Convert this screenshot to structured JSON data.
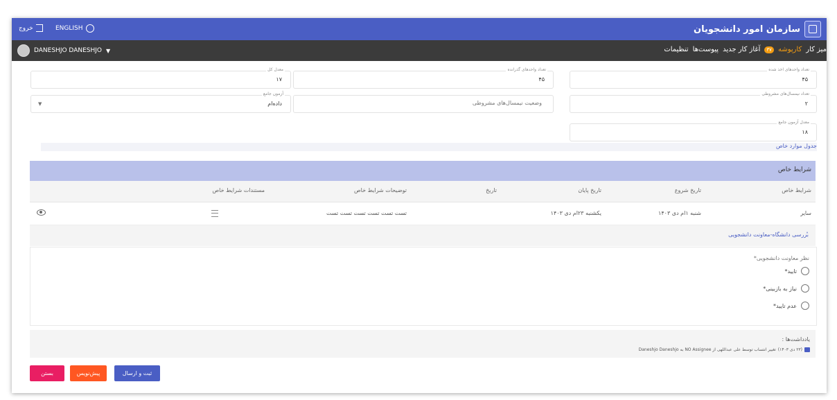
{
  "header": {
    "title": "سازمان امور دانشجویان",
    "language_label": "ENGLISH",
    "logout_label": "خروج",
    "accent_color": "#4a5ec4"
  },
  "nav": {
    "items": [
      {
        "label": "میز کار"
      },
      {
        "label": "کارپوشه",
        "active": true,
        "badge": "۳۷"
      },
      {
        "label": "آغاز کار جدید"
      },
      {
        "label": "پیوست‌ها"
      },
      {
        "label": "تنظیمات"
      }
    ],
    "user_name": "DANESHJO DANESHJO"
  },
  "form": {
    "gpa": {
      "label": "معدل کل",
      "value": "۱۷"
    },
    "units_passed": {
      "label": "تعداد واحدهای گذرانده",
      "value": "۴۵"
    },
    "units_taken": {
      "label": "تعداد واحدهای اخذ شده",
      "value": "۴۵"
    },
    "comprehensive_exam": {
      "label": "آزمون جامع",
      "value": "داده‌ام"
    },
    "probation_status": {
      "placeholder": "وضعیت نیمسال‌های مشروطی"
    },
    "probation_terms": {
      "label": "تعداد نیمسال‌های مشروطی",
      "value": "۲"
    },
    "exam_grade": {
      "label": "معدل آزمون جامع",
      "value": "۱۸"
    }
  },
  "special_section_link": "جدول موارد خاص",
  "special_conditions": {
    "title": "شرایط خاص",
    "columns": [
      "شرایط خاص",
      "تاریخ شروع",
      "تاریخ پایان",
      "تاریخ",
      "توضیحات شرایط خاص",
      "مستندات شرایط خاص"
    ],
    "rows": [
      {
        "condition": "سایر",
        "start": "شنبه ۱ام دی ۱۴۰۳",
        "end": "یکشنبه ۲۳ام دی ۱۴۰۳",
        "date": "",
        "description": "تست تست تست تست تست تست"
      }
    ]
  },
  "review": {
    "title": "بررسی دانشگاه-معاونت دانشجویی",
    "question": "نظر معاونت دانشجویی*",
    "options": [
      "تایید*",
      "نیاز به بازبینی*",
      "عدم تایید*"
    ]
  },
  "notes": {
    "title": "یادداشت‌ها :",
    "entry": "تغییر انتساب توسط علی عبداللهی از NO Assignee به Daneshjo Daneshjo",
    "date": "(۲۳ دی ۱۴۰۳)"
  },
  "buttons": {
    "submit": "ثبت و ارسال",
    "draft": "پیش‌نویس",
    "close": "بستن"
  }
}
